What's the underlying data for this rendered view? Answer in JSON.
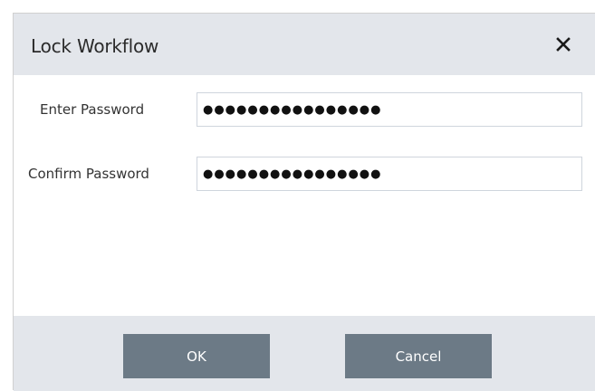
{
  "dialog": {
    "title": "Lock Workflow",
    "close_icon": "close-icon"
  },
  "form": {
    "enter_password": {
      "label": "Enter Password",
      "value": "●●●●●●●●●●●●●●●●"
    },
    "confirm_password": {
      "label": "Confirm Password",
      "value": "●●●●●●●●●●●●●●●●"
    }
  },
  "footer": {
    "ok_label": "OK",
    "cancel_label": "Cancel"
  },
  "colors": {
    "titlebar_bg": "#e3e6eb",
    "button_bg": "#6c7a86",
    "button_text": "#ffffff"
  }
}
